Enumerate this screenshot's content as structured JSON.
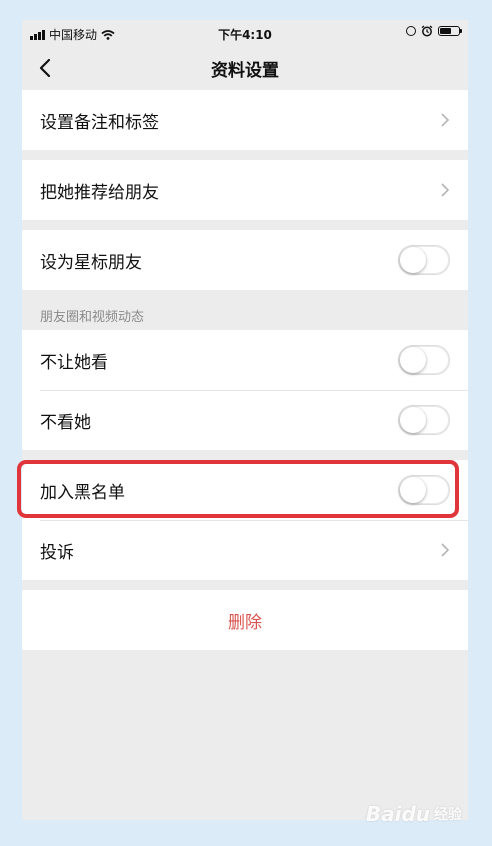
{
  "status_bar": {
    "carrier": "中国移动",
    "time": "下午4:10"
  },
  "nav": {
    "title": "资料设置",
    "back_icon": "chevron-left-icon"
  },
  "groups": {
    "remark": {
      "label": "设置备注和标签"
    },
    "recommend": {
      "label": "把她推荐给朋友"
    },
    "star": {
      "label": "设为星标朋友",
      "on": false
    }
  },
  "moments": {
    "header": "朋友圈和视频动态",
    "hide_mine": {
      "label": "不让她看",
      "on": false
    },
    "hide_hers": {
      "label": "不看她",
      "on": false
    }
  },
  "blacklist": {
    "label": "加入黑名单",
    "on": false
  },
  "report": {
    "label": "投诉"
  },
  "delete_label": "删除",
  "colors": {
    "delete": "#d9534f",
    "highlight": "#e0363b",
    "background": "#ececec"
  },
  "watermark": {
    "logo": "Baidu",
    "text": "经验"
  }
}
